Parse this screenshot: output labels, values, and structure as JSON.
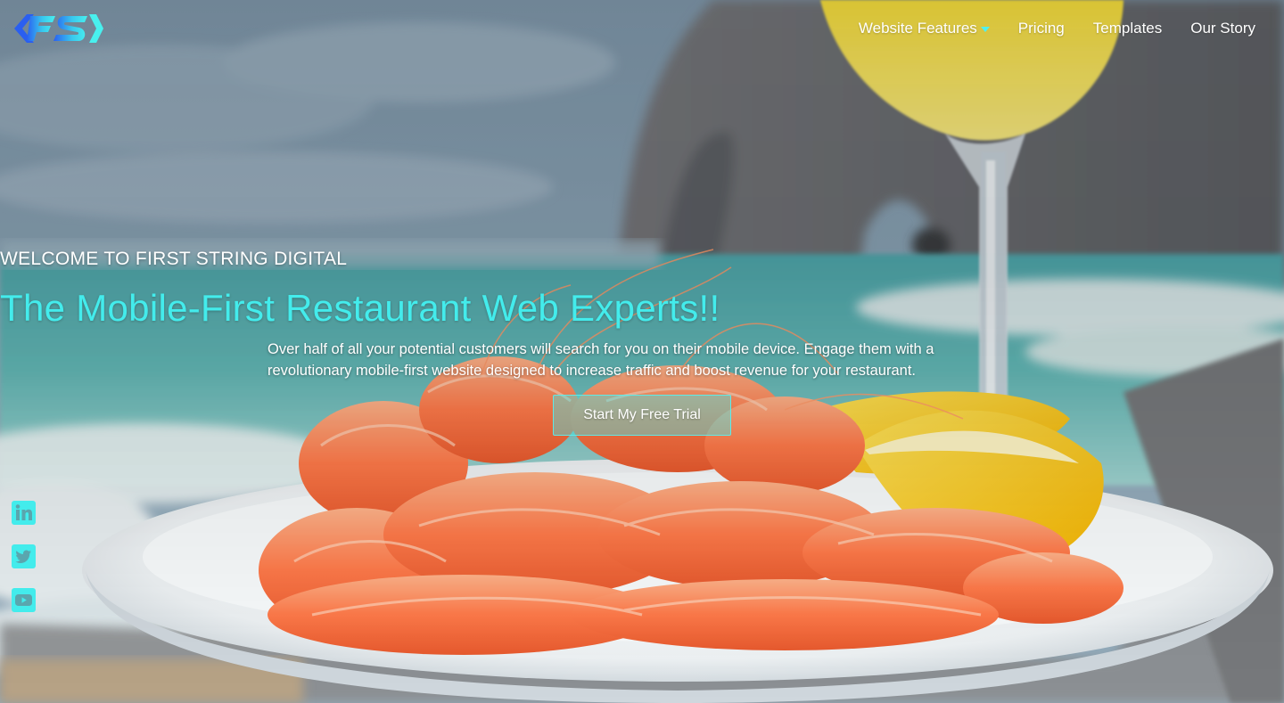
{
  "header": {
    "logo_text": "FS",
    "nav": [
      {
        "label": "Website Features",
        "has_dropdown": true
      },
      {
        "label": "Pricing"
      },
      {
        "label": "Templates"
      },
      {
        "label": "Our Story"
      }
    ]
  },
  "hero": {
    "eyebrow": "WELCOME TO FIRST STRING DIGITAL",
    "headline": "The Mobile-First Restaurant Web Experts!!",
    "subtext": "Over half of all your potential customers will search for you on their mobile device. Engage them with a revolutionary mobile-first website designed to increase traffic and boost revenue for your restaurant.",
    "cta_label": "Start My Free Trial",
    "background": "restaurant shrimp plate with lemon and white wine by the sea"
  },
  "social": [
    {
      "name": "linkedin-icon"
    },
    {
      "name": "twitter-icon"
    },
    {
      "name": "youtube-icon"
    }
  ],
  "colors": {
    "accent": "#43ecec",
    "logo_blue": "#2a6cf0",
    "logo_cyan": "#40f0ee",
    "nav_text": "#ffffff"
  }
}
